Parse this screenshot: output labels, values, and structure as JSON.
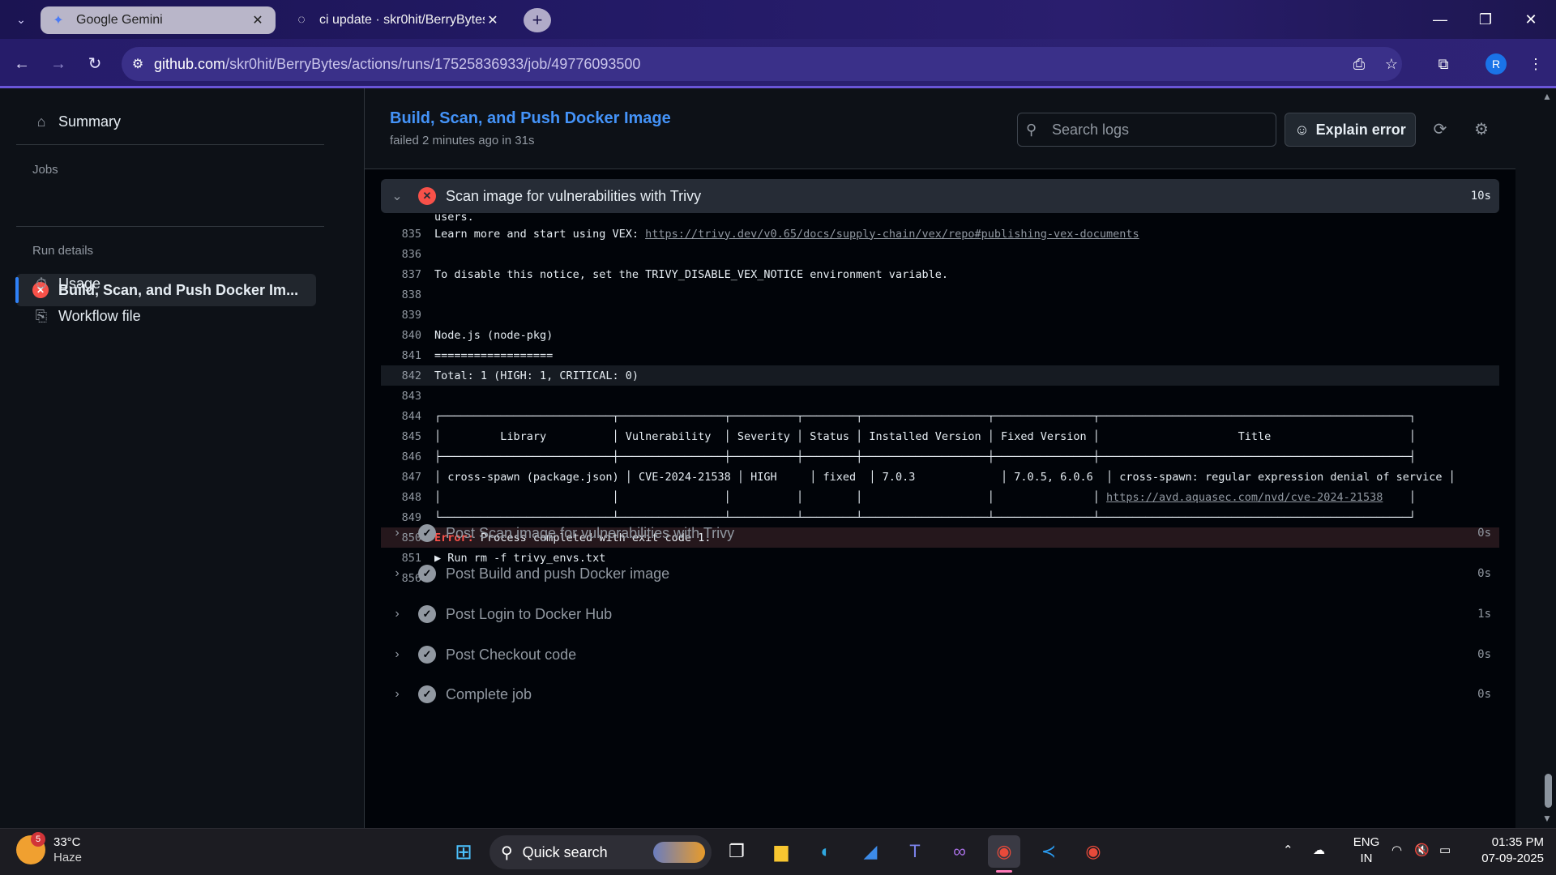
{
  "browser": {
    "tabs": [
      {
        "title": "Google Gemini",
        "active": true
      },
      {
        "title": "ci update · skr0hit/BerryBytes@",
        "active": false
      }
    ],
    "url_host": "github.com",
    "url_path": "/skr0hit/BerryBytes/actions/runs/17525836933/job/49776093500",
    "avatar_letter": "R"
  },
  "sidebar": {
    "summary_label": "Summary",
    "jobs_heading": "Jobs",
    "job_label": "Build, Scan, and Push Docker Im...",
    "run_details_heading": "Run details",
    "usage_label": "Usage",
    "workflow_label": "Workflow file"
  },
  "job": {
    "title": "Build, Scan, and Push Docker Image",
    "status": "failed 2 minutes ago in 31s",
    "search_placeholder": "Search logs",
    "explain_label": "Explain error"
  },
  "open_step": {
    "name": "Scan image for vulnerabilities with Trivy",
    "duration": "10s"
  },
  "log_partial_top": "users.",
  "log": [
    {
      "n": "835",
      "text": "Learn more and start using VEX: ",
      "link": "https://trivy.dev/v0.65/docs/supply-chain/vex/repo#publishing-vex-documents"
    },
    {
      "n": "836",
      "text": ""
    },
    {
      "n": "837",
      "text": "To disable this notice, set the TRIVY_DISABLE_VEX_NOTICE environment variable."
    },
    {
      "n": "838",
      "text": ""
    },
    {
      "n": "839",
      "text": ""
    },
    {
      "n": "840",
      "text": "Node.js (node-pkg)"
    },
    {
      "n": "841",
      "text": "=================="
    },
    {
      "n": "842",
      "text": "Total: 1 (HIGH: 1, CRITICAL: 0)"
    },
    {
      "n": "843",
      "text": ""
    },
    {
      "n": "844",
      "text": "┌──────────────────────────┬────────────────┬──────────┬────────┬───────────────────┬───────────────┬───────────────────────────────────────────────┐"
    },
    {
      "n": "845",
      "text": "│         Library          │ Vulnerability  │ Severity │ Status │ Installed Version │ Fixed Version │                     Title                     │"
    },
    {
      "n": "846",
      "text": "├──────────────────────────┼────────────────┼──────────┼────────┼───────────────────┼───────────────┼───────────────────────────────────────────────┤"
    },
    {
      "n": "847",
      "text": "│ cross-spawn (package.json) │ CVE-2024-21538 │ HIGH     │ fixed  │ 7.0.3             │ 7.0.5, 6.0.6  │ cross-spawn: regular expression denial of service │"
    },
    {
      "n": "848",
      "text": "│                          │                │          │        │                   │               │ ",
      "link": "https://avd.aquasec.com/nvd/cve-2024-21538",
      "tail": "    │"
    },
    {
      "n": "849",
      "text": "└──────────────────────────┴────────────────┴──────────┴────────┴───────────────────┴───────────────┴───────────────────────────────────────────────┘"
    },
    {
      "n": "850",
      "error_label": "Error:",
      "text": " Process completed with exit code 1."
    },
    {
      "n": "851",
      "text": "▶ Run rm -f trivy_envs.txt"
    },
    {
      "n": "856",
      "text": ""
    }
  ],
  "steps": [
    {
      "name": "Post Scan image for vulnerabilities with Trivy",
      "duration": "0s"
    },
    {
      "name": "Post Build and push Docker image",
      "duration": "0s"
    },
    {
      "name": "Post Login to Docker Hub",
      "duration": "1s"
    },
    {
      "name": "Post Checkout code",
      "duration": "0s"
    },
    {
      "name": "Complete job",
      "duration": "0s"
    }
  ],
  "taskbar": {
    "weather_temp": "33°C",
    "weather_desc": "Haze",
    "weather_badge": "5",
    "search_label": "Quick search",
    "lang_top": "ENG",
    "lang_bottom": "IN",
    "time": "01:35 PM",
    "date": "07-09-2025"
  }
}
